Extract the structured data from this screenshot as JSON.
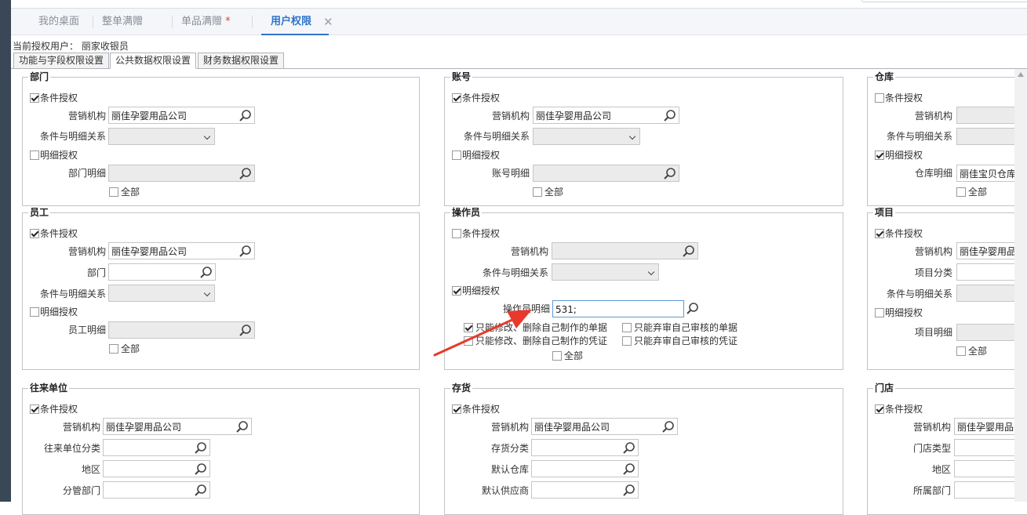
{
  "tabs": [
    {
      "label": "我的桌面",
      "star": ""
    },
    {
      "label": "整单满赠",
      "star": ""
    },
    {
      "label": "单品满赠",
      "star": "*"
    },
    {
      "label": "用户权限",
      "star": ""
    }
  ],
  "tab_close": "✕",
  "current_user": {
    "label": "当前授权用户：",
    "value": "丽家收银员"
  },
  "sub_tabs": [
    "功能与字段权限设置",
    "公共数据权限设置",
    "财务数据权限设置"
  ],
  "common": {
    "cond_auth": "条件授权",
    "detail_auth": "明细授权",
    "marketing_org": "营销机构",
    "relation": "条件与明细关系",
    "all": "全部",
    "company": "丽佳孕婴用品公司"
  },
  "sections": {
    "dept": {
      "title": "部门",
      "detail_label": "部门明细"
    },
    "account": {
      "title": "账号",
      "detail_label": "账号明细"
    },
    "warehouse": {
      "title": "仓库",
      "detail_label": "仓库明细",
      "detail_value": "丽佳宝贝仓库;"
    },
    "employee": {
      "title": "员工",
      "dept_label": "部门",
      "detail_label": "员工明细"
    },
    "operator": {
      "title": "操作员",
      "detail_label": "操作员明细",
      "detail_value": "531;",
      "options": [
        "只能修改、删除自己制作的单据",
        "只能修改、删除自己制作的凭证",
        "只能弃审自己审核的单据",
        "只能弃审自己审核的凭证"
      ]
    },
    "project": {
      "title": "项目",
      "category_label": "项目分类",
      "detail_label": "项目明细"
    },
    "partner": {
      "title": "往来单位",
      "category_label": "往来单位分类",
      "region_label": "地区",
      "branch_label": "分管部门"
    },
    "inventory": {
      "title": "存货",
      "category_label": "存货分类",
      "default_wh_label": "默认仓库",
      "default_supplier_label": "默认供应商"
    },
    "store": {
      "title": "门店",
      "type_label": "门店类型",
      "region_label": "地区",
      "dept_label": "所属部门"
    }
  },
  "colors": {
    "accent": "#2f73c9",
    "arrow": "#e8392c",
    "sidebar": "#3a4756"
  }
}
